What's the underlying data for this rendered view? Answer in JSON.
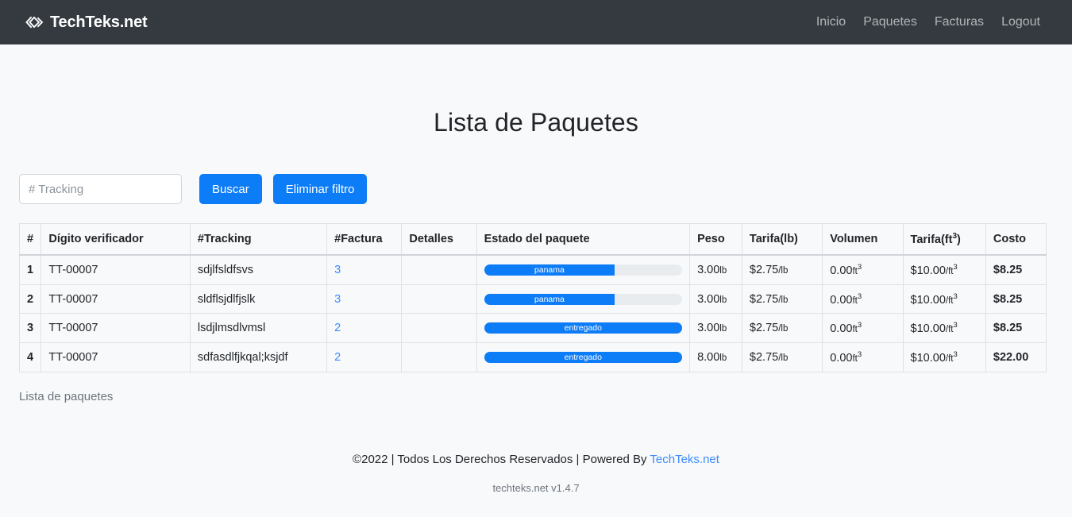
{
  "navbar": {
    "brand": "TechTeks.net",
    "brand_icon": "double-chevron-icon",
    "links": [
      {
        "label": "Inicio"
      },
      {
        "label": "Paquetes"
      },
      {
        "label": "Facturas"
      },
      {
        "label": "Logout"
      }
    ],
    "background_color": "#343a40"
  },
  "page": {
    "title": "Lista de Paquetes",
    "background_color": "#f8f9fa",
    "accent_color": "#0d7cf7",
    "link_color": "#3d8bfd"
  },
  "filter": {
    "input_value": "",
    "input_placeholder": "# Tracking",
    "search_label": "Buscar",
    "clear_label": "Eliminar filtro"
  },
  "table": {
    "headers": {
      "index": "#",
      "digito": "Dígito verificador",
      "tracking": "#Tracking",
      "factura": "#Factura",
      "detalles": "Detalles",
      "estado": "Estado del paquete",
      "peso": "Peso",
      "tarifa_lb": "Tarifa(lb)",
      "volumen": "Volumen",
      "tarifa_ft_base": "Tarifa(ft",
      "tarifa_ft_sup": "3",
      "tarifa_ft_close": ")",
      "costo": "Costo"
    },
    "rows": [
      {
        "index": "1",
        "digito": "TT-00007",
        "tracking": "sdjlfsldfsvs",
        "factura": "3",
        "detalles": "",
        "estado_label": "panama",
        "estado_percent": 66,
        "peso_value": "3.00",
        "peso_unit": "lb",
        "tarifa_lb_value": "$2.75",
        "tarifa_lb_unit": "/lb",
        "volumen_value": "0.00",
        "volumen_unit": "ft",
        "volumen_sup": "3",
        "tarifa_ft_value": "$10.00",
        "tarifa_ft_unit": "/ft",
        "tarifa_ft_sup": "3",
        "costo": "$8.25"
      },
      {
        "index": "2",
        "digito": "TT-00007",
        "tracking": "sldflsjdlfjslk",
        "factura": "3",
        "detalles": "",
        "estado_label": "panama",
        "estado_percent": 66,
        "peso_value": "3.00",
        "peso_unit": "lb",
        "tarifa_lb_value": "$2.75",
        "tarifa_lb_unit": "/lb",
        "volumen_value": "0.00",
        "volumen_unit": "ft",
        "volumen_sup": "3",
        "tarifa_ft_value": "$10.00",
        "tarifa_ft_unit": "/ft",
        "tarifa_ft_sup": "3",
        "costo": "$8.25"
      },
      {
        "index": "3",
        "digito": "TT-00007",
        "tracking": "lsdjlmsdlvmsl",
        "factura": "2",
        "detalles": "",
        "estado_label": "entregado",
        "estado_percent": 100,
        "peso_value": "3.00",
        "peso_unit": "lb",
        "tarifa_lb_value": "$2.75",
        "tarifa_lb_unit": "/lb",
        "volumen_value": "0.00",
        "volumen_unit": "ft",
        "volumen_sup": "3",
        "tarifa_ft_value": "$10.00",
        "tarifa_ft_unit": "/ft",
        "tarifa_ft_sup": "3",
        "costo": "$8.25"
      },
      {
        "index": "4",
        "digito": "TT-00007",
        "tracking": "sdfasdlfjkqal;ksjdf",
        "factura": "2",
        "detalles": "",
        "estado_label": "entregado",
        "estado_percent": 100,
        "peso_value": "8.00",
        "peso_unit": "lb",
        "tarifa_lb_value": "$2.75",
        "tarifa_lb_unit": "/lb",
        "volumen_value": "0.00",
        "volumen_unit": "ft",
        "volumen_sup": "3",
        "tarifa_ft_value": "$10.00",
        "tarifa_ft_unit": "/ft",
        "tarifa_ft_sup": "3",
        "costo": "$22.00"
      }
    ],
    "caption": "Lista de paquetes"
  },
  "footer": {
    "text_before": "©2022 | Todos Los Derechos Reservados | Powered By ",
    "link": "TechTeks.net",
    "version": "techteks.net v1.4.7"
  }
}
